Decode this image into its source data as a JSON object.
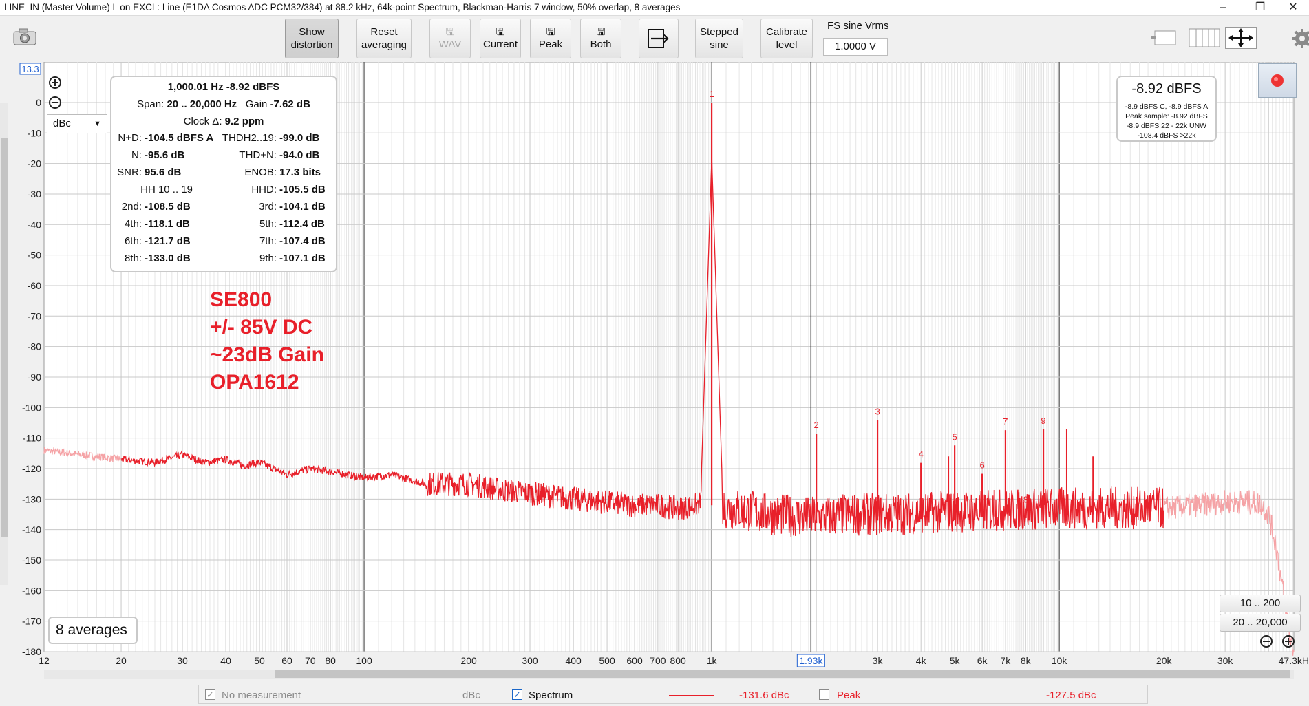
{
  "window": {
    "title": "LINE_IN (Master Volume) L on EXCL: Line (E1DA Cosmos ADC PCM32/384) at 88.2 kHz, 64k-point Spectrum, Blackman-Harris 7 window, 50% overlap, 8 averages",
    "minimize": "–",
    "restore": "❐",
    "close": "✕"
  },
  "toolbar": {
    "show_distortion": [
      "Show",
      "distortion"
    ],
    "reset_averaging": [
      "Reset",
      "averaging"
    ],
    "wav": "WAV",
    "current": "Current",
    "peak": "Peak",
    "both": "Both",
    "stepped_sine": [
      "Stepped",
      "sine"
    ],
    "calibrate_level": [
      "Calibrate",
      "level"
    ],
    "fs_label": "FS sine Vrms",
    "fs_value": "1.0000 V"
  },
  "info": {
    "row1": "1,000.01 Hz  -8.92 dBFS",
    "span_label": "Span:",
    "span_value": "20 .. 20,000 Hz",
    "gain_label": "Gain",
    "gain_value": "-7.62 dB",
    "clock_label": "Clock Δ:",
    "clock_value": "9.2 ppm",
    "rows": [
      {
        "l1": "N+D:",
        "v1": "-104.5 dBFS A",
        "l2": "THDH2..19:",
        "v2": "-99.0 dB"
      },
      {
        "l1": "N:",
        "v1": "-95.6 dB",
        "l2": "THD+N:",
        "v2": "-94.0 dB"
      },
      {
        "l1": "SNR:",
        "v1": "95.6 dB",
        "l2": "ENOB:",
        "v2": "17.3 bits"
      },
      {
        "l1": "HH 10 .. 19",
        "v1": "",
        "l2": "HHD:",
        "v2": "-105.5 dB"
      },
      {
        "l1": "2nd:",
        "v1": "-108.5 dB",
        "l2": "3rd:",
        "v2": "-104.1 dB"
      },
      {
        "l1": "4th:",
        "v1": "-118.1 dB",
        "l2": "5th:",
        "v2": "-112.4 dB"
      },
      {
        "l1": "6th:",
        "v1": "-121.7 dB",
        "l2": "7th:",
        "v2": "-107.4 dB"
      },
      {
        "l1": "8th:",
        "v1": "-133.0 dB",
        "l2": "9th:",
        "v2": "-107.1 dB"
      }
    ]
  },
  "level_box": {
    "main": "-8.92 dBFS",
    "lines": [
      "-8.9 dBFS C, -8.9 dBFS A",
      "Peak sample: -8.92 dBFS",
      "-8.9 dBFS 22 - 22k UNW",
      "-108.4 dBFS >22k"
    ]
  },
  "annotation": [
    "SE800",
    "+/- 85V DC",
    "~23dB Gain",
    "OPA1612"
  ],
  "averages_badge": "8 averages",
  "unit_select": "dBc",
  "range_buttons": [
    "10 .. 200",
    "20 .. 20,000"
  ],
  "legend": {
    "no_measurement": "No measurement",
    "no_measurement_unit": "dBc",
    "spectrum": "Spectrum",
    "spectrum_value": "-131.6 dBc",
    "peak": "Peak",
    "peak_value": "-127.5 dBc"
  },
  "colors": {
    "trace": "#e8202a",
    "trace_faded": "#f5a3a6",
    "grid": "#c8c8c8",
    "marker": "#1f5fd0"
  },
  "chart_data": {
    "type": "line",
    "ylabel": "dBc",
    "y_top_readout": "13.3",
    "xscale": "log",
    "xlim": [
      12,
      47300
    ],
    "ylim": [
      -180,
      13.3
    ],
    "x_ticks": [
      12,
      20,
      30,
      40,
      50,
      60,
      70,
      80,
      100,
      200,
      300,
      400,
      500,
      600,
      700,
      800,
      1000,
      2000,
      3000,
      4000,
      5000,
      6000,
      7000,
      8000,
      10000,
      20000,
      30000,
      47300
    ],
    "x_tick_labels": [
      "12",
      "20",
      "30",
      "40",
      "50",
      "60",
      "70",
      "80",
      "100",
      "200",
      "300",
      "400",
      "500",
      "600",
      "700",
      "800",
      "1k",
      "2k",
      "3k",
      "4k",
      "5k",
      "6k",
      "7k",
      "8k",
      "10k",
      "20k",
      "30k",
      "47.3kH"
    ],
    "y_ticks": [
      0,
      -10,
      -20,
      -30,
      -40,
      -50,
      -60,
      -70,
      -80,
      -90,
      -100,
      -110,
      -120,
      -130,
      -140,
      -150,
      -160,
      -170,
      -180
    ],
    "cursor_x": 1930,
    "cursor_label": "1.93k",
    "harmonics": [
      {
        "label": "1",
        "x": 1000,
        "y": 0
      },
      {
        "label": "2",
        "x": 2000,
        "y": -108.5
      },
      {
        "label": "3",
        "x": 3000,
        "y": -104.1
      },
      {
        "label": "4",
        "x": 4000,
        "y": -118.1
      },
      {
        "label": "5",
        "x": 5000,
        "y": -112.4
      },
      {
        "label": "6",
        "x": 6000,
        "y": -121.7
      },
      {
        "label": "7",
        "x": 7000,
        "y": -107.4
      },
      {
        "label": "8",
        "x": 8000,
        "y": -133.0
      },
      {
        "label": "9",
        "x": 9000,
        "y": -107.1
      }
    ],
    "extra_spurs": [
      {
        "x": 4800,
        "y": -116
      },
      {
        "x": 6500,
        "y": -127
      },
      {
        "x": 10500,
        "y": -107
      },
      {
        "x": 12500,
        "y": -116
      }
    ],
    "series": [
      {
        "name": "Spectrum",
        "x": [
          12,
          20,
          25,
          30,
          35,
          40,
          45,
          50,
          60,
          70,
          80,
          100,
          120,
          150,
          200,
          250,
          300,
          400,
          500,
          600,
          700,
          800,
          900,
          960,
          1040,
          1100,
          1300,
          1500,
          1700,
          1930,
          2500,
          3000,
          4000,
          5000,
          6000,
          7000,
          8000,
          9000,
          10000,
          12000,
          15000,
          20000,
          25000,
          30000,
          35000,
          38000,
          40000,
          42000,
          44000,
          46000,
          47300
        ],
        "y": [
          -114,
          -117,
          -118,
          -115.5,
          -118,
          -117,
          -119,
          -118,
          -122,
          -120,
          -121,
          -123,
          -122,
          -125,
          -125,
          -127,
          -128,
          -130,
          -131,
          -132,
          -132,
          -133,
          -132,
          -130,
          -130,
          -133,
          -134,
          -135,
          -135.5,
          -136,
          -135,
          -135,
          -134.5,
          -134,
          -134,
          -133.5,
          -133.5,
          -133,
          -133,
          -133,
          -133,
          -133,
          -132,
          -131,
          -131,
          -131.5,
          -135,
          -145,
          -160,
          -175,
          -180
        ]
      }
    ]
  }
}
